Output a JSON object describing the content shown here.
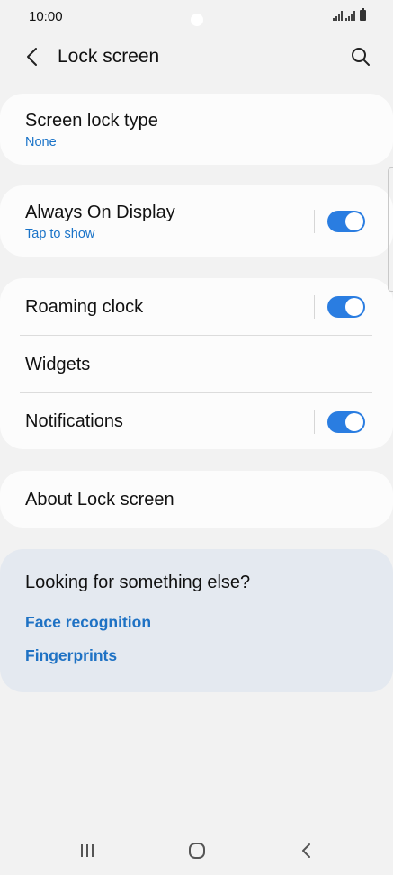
{
  "status_bar": {
    "time": "10:00",
    "icons": [
      "signal-icon",
      "signal-icon",
      "battery-icon"
    ]
  },
  "header": {
    "title": "Lock screen",
    "back_icon": "chevron-left-icon",
    "search_icon": "search-icon"
  },
  "settings": {
    "screen_lock_type": {
      "title": "Screen lock type",
      "subtitle": "None"
    },
    "always_on_display": {
      "title": "Always On Display",
      "subtitle": "Tap to show",
      "toggle_on": true
    },
    "roaming_clock": {
      "title": "Roaming clock",
      "toggle_on": true
    },
    "widgets": {
      "title": "Widgets"
    },
    "notifications": {
      "title": "Notifications",
      "toggle_on": true
    },
    "about": {
      "title": "About Lock screen"
    }
  },
  "suggestions": {
    "title": "Looking for something else?",
    "links": [
      "Face recognition",
      "Fingerprints"
    ]
  },
  "nav_bar": {
    "icons": [
      "recent-apps-icon",
      "home-icon",
      "back-icon"
    ]
  },
  "colors": {
    "background": "#f2f2f2",
    "card": "#fcfcfc",
    "accent": "#2a7de1",
    "link": "#1f72c4",
    "suggestion_card": "#e4e9f0"
  }
}
